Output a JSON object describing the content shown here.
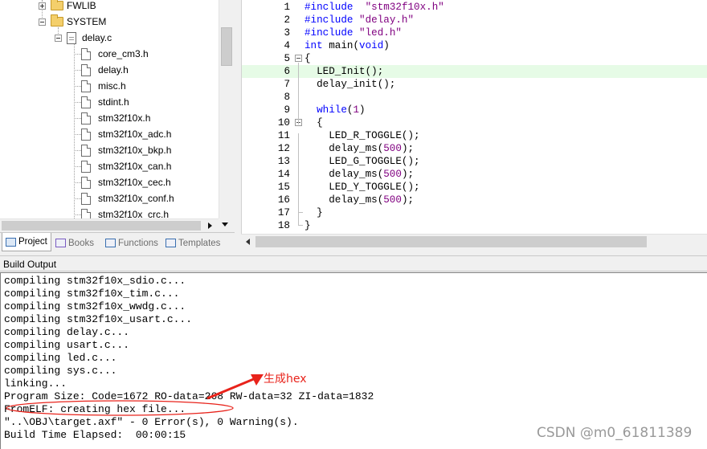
{
  "project_tree": {
    "items": [
      {
        "label": "FWLIB",
        "kind": "folder",
        "expander": "plus"
      },
      {
        "label": "SYSTEM",
        "kind": "folder",
        "expander": "minus"
      },
      {
        "label": "delay.c",
        "kind": "c-file",
        "expander": "minus"
      },
      {
        "label": "core_cm3.h",
        "kind": "h-file"
      },
      {
        "label": "delay.h",
        "kind": "h-file"
      },
      {
        "label": "misc.h",
        "kind": "h-file"
      },
      {
        "label": "stdint.h",
        "kind": "h-file"
      },
      {
        "label": "stm32f10x.h",
        "kind": "h-file"
      },
      {
        "label": "stm32f10x_adc.h",
        "kind": "h-file"
      },
      {
        "label": "stm32f10x_bkp.h",
        "kind": "h-file"
      },
      {
        "label": "stm32f10x_can.h",
        "kind": "h-file"
      },
      {
        "label": "stm32f10x_cec.h",
        "kind": "h-file"
      },
      {
        "label": "stm32f10x_conf.h",
        "kind": "h-file"
      },
      {
        "label": "stm32f10x_crc.h",
        "kind": "h-file"
      }
    ]
  },
  "panel_tabs": [
    {
      "label": "Project",
      "active": true,
      "icon": "project-icon"
    },
    {
      "label": "Books",
      "active": false,
      "icon": "books-icon"
    },
    {
      "label": "Functions",
      "active": false,
      "icon": "functions-icon"
    },
    {
      "label": "Templates",
      "active": false,
      "icon": "templates-icon"
    }
  ],
  "editor": {
    "highlighted_line": 6,
    "lines": [
      {
        "n": "1",
        "code": "#include  \"stm32f10x.h\""
      },
      {
        "n": "2",
        "code": "#include \"delay.h\""
      },
      {
        "n": "3",
        "code": "#include \"led.h\""
      },
      {
        "n": "4",
        "code": "int main(void)"
      },
      {
        "n": "5",
        "code": "{"
      },
      {
        "n": "6",
        "code": "  LED_Init();"
      },
      {
        "n": "7",
        "code": "  delay_init();"
      },
      {
        "n": "8",
        "code": ""
      },
      {
        "n": "9",
        "code": "  while(1)"
      },
      {
        "n": "10",
        "code": "  {"
      },
      {
        "n": "11",
        "code": "    LED_R_TOGGLE();"
      },
      {
        "n": "12",
        "code": "    delay_ms(500);"
      },
      {
        "n": "13",
        "code": "    LED_G_TOGGLE();"
      },
      {
        "n": "14",
        "code": "    delay_ms(500);"
      },
      {
        "n": "15",
        "code": "    LED_Y_TOGGLE();"
      },
      {
        "n": "16",
        "code": "    delay_ms(500);"
      },
      {
        "n": "17",
        "code": "  }"
      },
      {
        "n": "18",
        "code": "}"
      }
    ]
  },
  "build_output": {
    "title": "Build Output",
    "lines": [
      "compiling stm32f10x_sdio.c...",
      "compiling stm32f10x_tim.c...",
      "compiling stm32f10x_wwdg.c...",
      "compiling stm32f10x_usart.c...",
      "compiling delay.c...",
      "compiling usart.c...",
      "compiling led.c...",
      "compiling sys.c...",
      "linking...",
      "Program Size: Code=1672 RO-data=268 RW-data=32 ZI-data=1832",
      "FromELF: creating hex file...",
      "\"..\\OBJ\\target.axf\" - 0 Error(s), 0 Warning(s).",
      "Build Time Elapsed:  00:00:15"
    ]
  },
  "annotation": {
    "text": "生成hex",
    "color": "#e8231b"
  },
  "watermark": "CSDN @m0_61811389"
}
